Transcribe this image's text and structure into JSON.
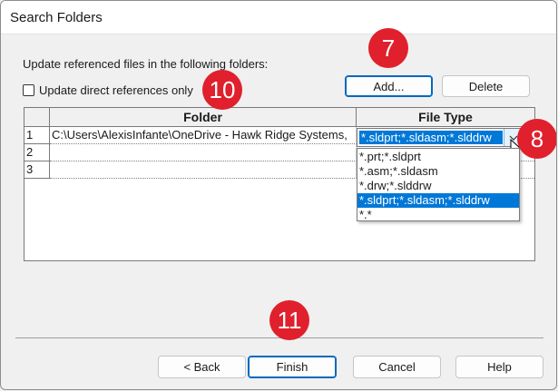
{
  "window": {
    "title": "Search Folders"
  },
  "instruction": "Update referenced files in the following folders:",
  "checkbox": {
    "label": "Update direct references only",
    "checked": false
  },
  "buttons": {
    "add": "Add...",
    "delete": "Delete",
    "back": "< Back",
    "finish": "Finish",
    "cancel": "Cancel",
    "help": "Help"
  },
  "table": {
    "headers": {
      "folder": "Folder",
      "file_type": "File Type"
    },
    "rows": [
      {
        "num": "1",
        "folder": "C:\\Users\\AlexisInfante\\OneDrive - Hawk Ridge Systems,",
        "file_type": "*.sldprt;*.sldasm;*.slddrw"
      },
      {
        "num": "2",
        "folder": "",
        "file_type": ""
      },
      {
        "num": "3",
        "folder": "",
        "file_type": ""
      }
    ]
  },
  "dropdown": {
    "selected": "*.sldprt;*.sldasm;*.slddrw",
    "options": [
      "*.prt;*.sldprt",
      "*.asm;*.sldasm",
      "*.drw;*.slddrw",
      "*.sldprt;*.sldasm;*.slddrw",
      "*.*"
    ]
  },
  "callouts": [
    "7",
    "8",
    "10",
    "11"
  ],
  "colors": {
    "accent": "#0078d7",
    "callout": "#e0202d"
  }
}
